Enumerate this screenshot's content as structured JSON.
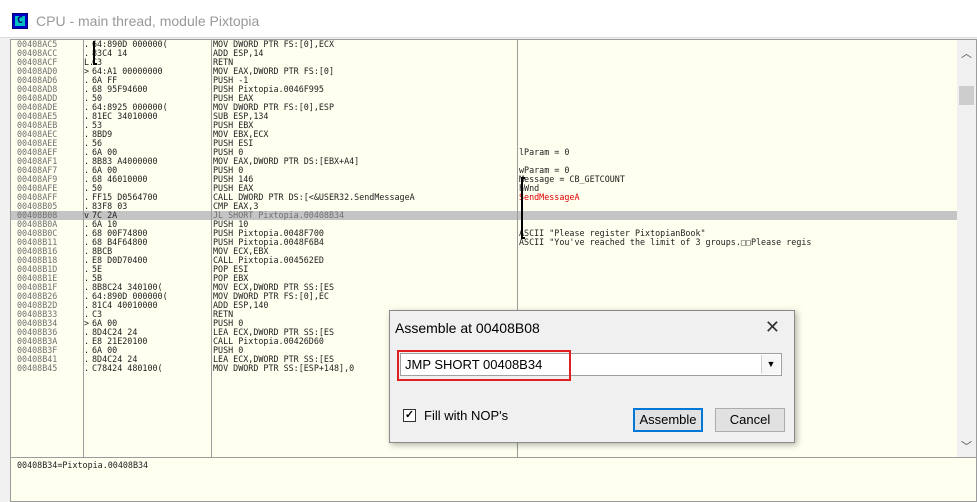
{
  "window": {
    "title": "CPU - main thread, module Pixtopia"
  },
  "icons": {
    "app": "cpu-icon",
    "close": "close-icon",
    "dropdown": "chevron-down-icon",
    "check": "checkmark-icon"
  },
  "colors": {
    "selected_row": "#c4c4c4",
    "api_name": "#e00000",
    "highlight_box": "#e02020",
    "pane_bg": "#fffff0"
  },
  "disasm": {
    "rows": [
      {
        "addr": "00408AC5",
        "mark": ".",
        "hex": "64:890D 000000(",
        "asm": "MOV DWORD PTR FS:[0],ECX",
        "cmt": ""
      },
      {
        "addr": "00408ACC",
        "mark": ".",
        "hex": "83C4 14",
        "asm": "ADD ESP,14",
        "cmt": ""
      },
      {
        "addr": "00408ACF",
        "mark": "L.",
        "hex": "C3",
        "asm": "RETN",
        "cmt": ""
      },
      {
        "addr": "00408AD0",
        "mark": ">",
        "hex": "64:A1 00000000",
        "asm": "MOV EAX,DWORD PTR FS:[0]",
        "cmt": ""
      },
      {
        "addr": "00408AD6",
        "mark": ".",
        "hex": "6A FF",
        "asm": "PUSH -1",
        "cmt": ""
      },
      {
        "addr": "00408AD8",
        "mark": ".",
        "hex": "68 95F94600",
        "asm": "PUSH Pixtopia.0046F995",
        "cmt": ""
      },
      {
        "addr": "00408ADD",
        "mark": ".",
        "hex": "50",
        "asm": "PUSH EAX",
        "cmt": ""
      },
      {
        "addr": "00408ADE",
        "mark": ".",
        "hex": "64:8925 000000(",
        "asm": "MOV DWORD PTR FS:[0],ESP",
        "cmt": ""
      },
      {
        "addr": "00408AE5",
        "mark": ".",
        "hex": "81EC 34010000",
        "asm": "SUB ESP,134",
        "cmt": ""
      },
      {
        "addr": "00408AEB",
        "mark": ".",
        "hex": "53",
        "asm": "PUSH EBX",
        "cmt": ""
      },
      {
        "addr": "00408AEC",
        "mark": ".",
        "hex": "8BD9",
        "asm": "MOV EBX,ECX",
        "cmt": ""
      },
      {
        "addr": "00408AEE",
        "mark": ".",
        "hex": "56",
        "asm": "PUSH ESI",
        "cmt": ""
      },
      {
        "addr": "00408AEF",
        "mark": ".",
        "hex": "6A 00",
        "asm": "PUSH 0",
        "cmt": "lParam = 0"
      },
      {
        "addr": "00408AF1",
        "mark": ".",
        "hex": "8B83 A4000000",
        "asm": "MOV EAX,DWORD PTR DS:[EBX+A4]",
        "cmt": ""
      },
      {
        "addr": "00408AF7",
        "mark": ".",
        "hex": "6A 00",
        "asm": "PUSH 0",
        "cmt": "wParam = 0"
      },
      {
        "addr": "00408AF9",
        "mark": ".",
        "hex": "68 46010000",
        "asm": "PUSH 146",
        "cmt": "Message = CB_GETCOUNT"
      },
      {
        "addr": "00408AFE",
        "mark": ".",
        "hex": "50",
        "asm": "PUSH EAX",
        "cmt": "hWnd"
      },
      {
        "addr": "00408AFF",
        "mark": ".",
        "hex": "FF15 D0564700",
        "asm": "CALL DWORD PTR DS:[<&USER32.SendMessageA",
        "cmt": "SendMessageA"
      },
      {
        "addr": "00408B05",
        "mark": ".",
        "hex": "83F8 03",
        "asm": "CMP EAX,3",
        "cmt": ""
      },
      {
        "addr": "00408B08",
        "mark": "v",
        "hex": "7C 2A",
        "asm": "JL SHORT Pixtopia.00408B34",
        "cmt": ""
      },
      {
        "addr": "00408B0A",
        "mark": ".",
        "hex": "6A 10",
        "asm": "PUSH 10",
        "cmt": ""
      },
      {
        "addr": "00408B0C",
        "mark": ".",
        "hex": "68 00F74800",
        "asm": "PUSH Pixtopia.0048F700",
        "cmt": "ASCII \"Please register PixtopianBook\""
      },
      {
        "addr": "00408B11",
        "mark": ".",
        "hex": "68 B4F64800",
        "asm": "PUSH Pixtopia.0048F6B4",
        "cmt": "ASCII \"You've reached the limit of 3 groups.□□Please regis"
      },
      {
        "addr": "00408B16",
        "mark": ".",
        "hex": "8BCB",
        "asm": "MOV ECX,EBX",
        "cmt": ""
      },
      {
        "addr": "00408B18",
        "mark": ".",
        "hex": "E8 D0D70400",
        "asm": "CALL Pixtopia.004562ED",
        "cmt": ""
      },
      {
        "addr": "00408B1D",
        "mark": ".",
        "hex": "5E",
        "asm": "POP ESI",
        "cmt": ""
      },
      {
        "addr": "00408B1E",
        "mark": ".",
        "hex": "5B",
        "asm": "POP EBX",
        "cmt": ""
      },
      {
        "addr": "00408B1F",
        "mark": ".",
        "hex": "8B8C24 340100(",
        "asm": "MOV ECX,DWORD PTR SS:[ES",
        "cmt": ""
      },
      {
        "addr": "00408B26",
        "mark": ".",
        "hex": "64:890D 000000(",
        "asm": "MOV DWORD PTR FS:[0],EC",
        "cmt": ""
      },
      {
        "addr": "00408B2D",
        "mark": ".",
        "hex": "81C4 40010000",
        "asm": "ADD ESP,140",
        "cmt": ""
      },
      {
        "addr": "00408B33",
        "mark": ".",
        "hex": "C3",
        "asm": "RETN",
        "cmt": ""
      },
      {
        "addr": "00408B34",
        "mark": ">",
        "hex": "6A 00",
        "asm": "PUSH 0",
        "cmt": ""
      },
      {
        "addr": "00408B36",
        "mark": ".",
        "hex": "8D4C24 24",
        "asm": "LEA ECX,DWORD PTR SS:[ES",
        "cmt": ""
      },
      {
        "addr": "00408B3A",
        "mark": ".",
        "hex": "E8 21E20100",
        "asm": "CALL Pixtopia.00426D60",
        "cmt": ""
      },
      {
        "addr": "00408B3F",
        "mark": ".",
        "hex": "6A 00",
        "asm": "PUSH 0",
        "cmt": ""
      },
      {
        "addr": "00408B41",
        "mark": ".",
        "hex": "8D4C24 24",
        "asm": "LEA ECX,DWORD PTR SS:[ES",
        "cmt": ""
      },
      {
        "addr": "00408B45",
        "mark": ".",
        "hex": "C78424 480100(",
        "asm": "MOV DWORD PTR SS:[ESP+148],0",
        "cmt": ""
      }
    ],
    "selected_index": 19,
    "red_comment_index": 17
  },
  "status": {
    "text": "00408B34=Pixtopia.00408B34"
  },
  "dialog": {
    "title": "Assemble at 00408B08",
    "input_value": "JMP SHORT 00408B34",
    "checkbox_label": "Fill with NOP's",
    "checkbox_checked": true,
    "assemble_label": "Assemble",
    "cancel_label": "Cancel"
  }
}
